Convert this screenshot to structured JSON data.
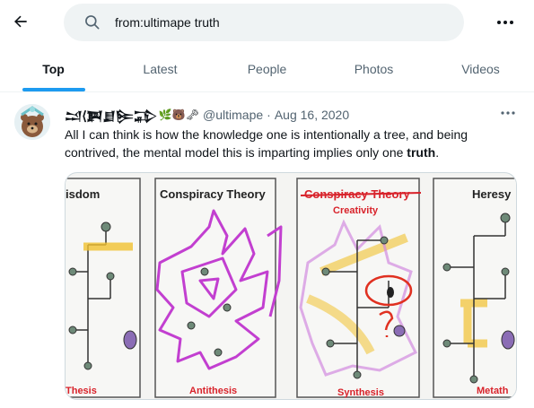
{
  "search": {
    "query": "from:ultimape truth"
  },
  "tabs": [
    {
      "label": "Top",
      "active": true
    },
    {
      "label": "Latest",
      "active": false
    },
    {
      "label": "People",
      "active": false
    },
    {
      "label": "Photos",
      "active": false
    },
    {
      "label": "Videos",
      "active": false
    }
  ],
  "tweet": {
    "display_name": "𒁺⟨𒀉𒋗𒌉𒁉",
    "display_emojis": "🌿🐻🗝",
    "handle": "@ultimape",
    "separator": "·",
    "date": "Aug 16, 2020",
    "text_before": "All I can think is how the knowledge one is intentionally a tree, and being contrived, the mental model this is imparting implies only one ",
    "text_bold": "truth",
    "text_after": ".",
    "image": {
      "panel_titles": [
        "isdom",
        "Conspiracy Theory",
        "Conspiracy Theory",
        "Heresy"
      ],
      "panel_annotation": "Creativity",
      "panel_captions": [
        "Thesis",
        "Antithesis",
        "Synthesis",
        "Metath"
      ]
    }
  },
  "colors": {
    "accent": "#1d9bf0",
    "caption_red": "#d8222a",
    "scribble_purple": "#c23fd0",
    "highlight_yellow": "#f2c230"
  }
}
